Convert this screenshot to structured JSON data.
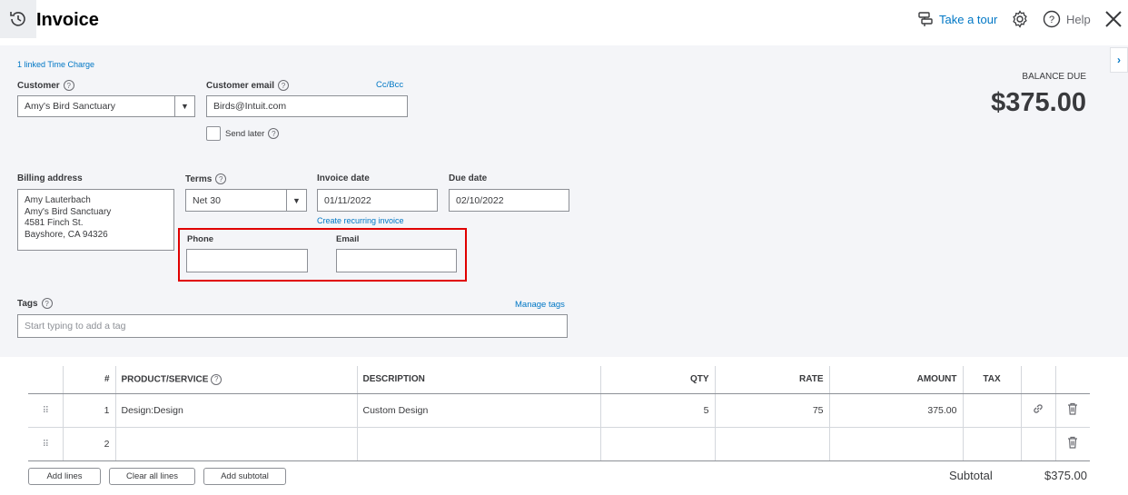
{
  "header": {
    "title": "Invoice",
    "take_tour": "Take a tour",
    "help": "Help"
  },
  "form": {
    "linked_charge": "1 linked Time Charge",
    "customer": {
      "label": "Customer",
      "value": "Amy's Bird Sanctuary"
    },
    "customer_email": {
      "label": "Customer email",
      "value": "Birds@Intuit.com",
      "cc_bcc": "Cc/Bcc"
    },
    "send_later": {
      "label": "Send later",
      "checked": false
    },
    "billing_address": {
      "label": "Billing address",
      "lines": [
        "Amy Lauterbach",
        "Amy's Bird Sanctuary",
        "4581 Finch St.",
        "Bayshore, CA  94326"
      ]
    },
    "terms": {
      "label": "Terms",
      "value": "Net 30"
    },
    "invoice_date": {
      "label": "Invoice date",
      "value": "01/11/2022"
    },
    "due_date": {
      "label": "Due date",
      "value": "02/10/2022"
    },
    "create_recurring": "Create recurring invoice",
    "phone": {
      "label": "Phone",
      "value": ""
    },
    "email": {
      "label": "Email",
      "value": ""
    },
    "tags": {
      "label": "Tags",
      "placeholder": "Start typing to add a tag",
      "manage": "Manage tags"
    },
    "balance_due": {
      "label": "BALANCE DUE",
      "amount": "$375.00"
    }
  },
  "table": {
    "headers": [
      "#",
      "PRODUCT/SERVICE",
      "DESCRIPTION",
      "QTY",
      "RATE",
      "AMOUNT",
      "TAX"
    ],
    "rows": [
      {
        "num": "1",
        "product": "Design:Design",
        "description": "Custom Design",
        "qty": "5",
        "rate": "75",
        "amount": "375.00",
        "tax": ""
      },
      {
        "num": "2",
        "product": "",
        "description": "",
        "qty": "",
        "rate": "",
        "amount": "",
        "tax": ""
      }
    ]
  },
  "footer": {
    "add_lines": "Add lines",
    "clear_all": "Clear all lines",
    "add_subtotal": "Add subtotal",
    "subtotal_label": "Subtotal",
    "subtotal_value": "$375.00"
  },
  "colors": {
    "link": "#0077c5",
    "highlight": "#e00000",
    "form_bg": "#f4f5f8"
  }
}
